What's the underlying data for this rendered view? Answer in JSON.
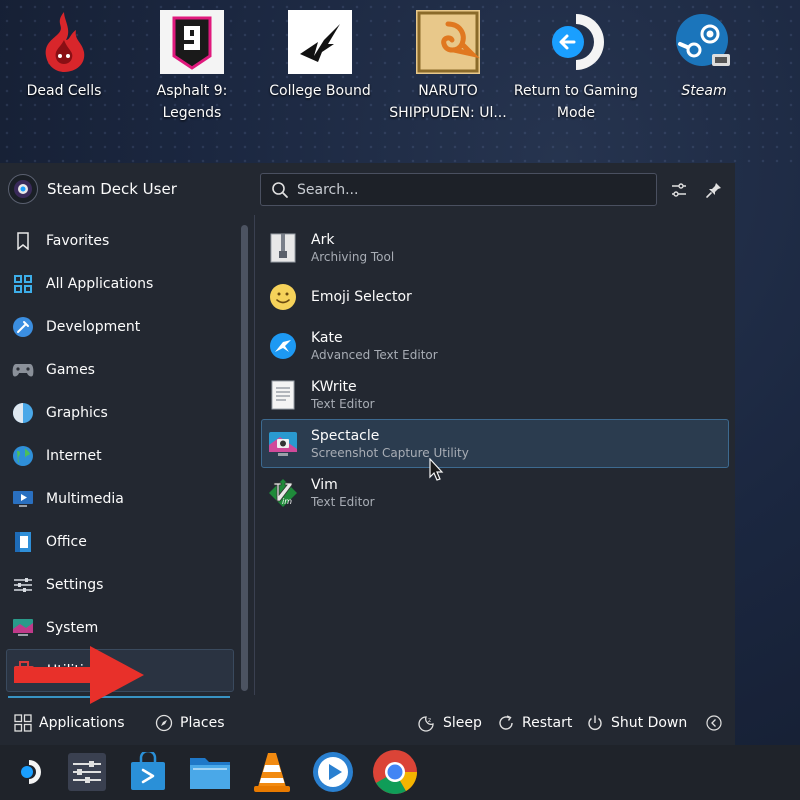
{
  "desktop": {
    "icons": [
      {
        "label": "Dead Cells"
      },
      {
        "label": "Asphalt 9: Legends"
      },
      {
        "label": "College Bound"
      },
      {
        "label": "NARUTO SHIPPUDEN: Ul..."
      },
      {
        "label": "Return to Gaming Mode"
      },
      {
        "label": "Steam"
      }
    ]
  },
  "launcher": {
    "user_name": "Steam Deck User",
    "search_placeholder": "Search...",
    "categories": [
      {
        "label": "Favorites",
        "icon": "bookmark-icon"
      },
      {
        "label": "All Applications",
        "icon": "grid-icon"
      },
      {
        "label": "Development",
        "icon": "development-icon"
      },
      {
        "label": "Games",
        "icon": "gamepad-icon"
      },
      {
        "label": "Graphics",
        "icon": "graphics-icon"
      },
      {
        "label": "Internet",
        "icon": "globe-icon"
      },
      {
        "label": "Multimedia",
        "icon": "multimedia-icon"
      },
      {
        "label": "Office",
        "icon": "office-icon"
      },
      {
        "label": "Settings",
        "icon": "settings-sliders-icon"
      },
      {
        "label": "System",
        "icon": "system-icon"
      },
      {
        "label": "Utilities",
        "icon": "toolbox-icon"
      }
    ],
    "active_category": "Utilities",
    "apps": [
      {
        "name": "Ark",
        "desc": "Archiving Tool",
        "icon": "archive-icon"
      },
      {
        "name": "Emoji Selector",
        "desc": "",
        "icon": "emoji-icon"
      },
      {
        "name": "Kate",
        "desc": "Advanced Text Editor",
        "icon": "kate-icon"
      },
      {
        "name": "KWrite",
        "desc": "Text Editor",
        "icon": "document-icon"
      },
      {
        "name": "Spectacle",
        "desc": "Screenshot Capture Utility",
        "icon": "camera-icon"
      },
      {
        "name": "Vim",
        "desc": "Text Editor",
        "icon": "vim-icon"
      }
    ],
    "highlighted_app": "Spectacle",
    "footer": {
      "applications": "Applications",
      "places": "Places",
      "sleep": "Sleep",
      "restart": "Restart",
      "shutdown": "Shut Down"
    }
  },
  "colors": {
    "accent": "#3daee9",
    "panel_bg": "#232831",
    "taskbar_bg": "#1f232a",
    "arrow": "#e8302a"
  }
}
